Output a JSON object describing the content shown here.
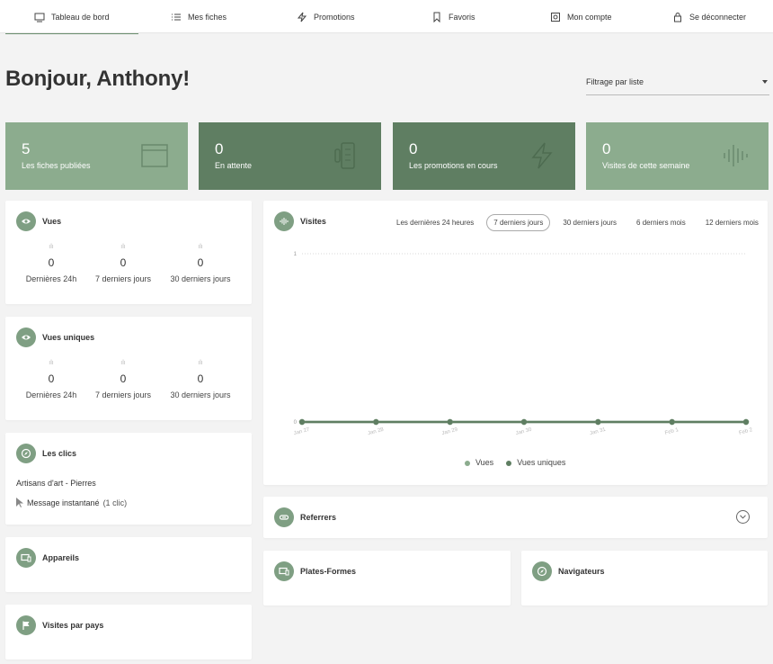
{
  "nav": {
    "items": [
      {
        "label": "Tableau de bord",
        "icon": "monitor-icon"
      },
      {
        "label": "Mes fiches",
        "icon": "list-icon"
      },
      {
        "label": "Promotions",
        "icon": "bolt-icon"
      },
      {
        "label": "Favoris",
        "icon": "bookmark-icon"
      },
      {
        "label": "Mon compte",
        "icon": "settings-icon"
      },
      {
        "label": "Se déconnecter",
        "icon": "lock-icon"
      }
    ],
    "active": "Tableau de bord"
  },
  "header": {
    "greeting": "Bonjour, Anthony!",
    "filter_label": "Filtrage par liste"
  },
  "stats": [
    {
      "value": "5",
      "label": "Les fiches publiées",
      "icon": "browser-icon"
    },
    {
      "value": "0",
      "label": "En attente",
      "icon": "battery-icon"
    },
    {
      "value": "0",
      "label": "Les promotions en cours",
      "icon": "bolt-icon"
    },
    {
      "value": "0",
      "label": "Visites de cette semaine",
      "icon": "soundwave-icon"
    }
  ],
  "vues": {
    "title": "Vues",
    "metrics": [
      {
        "value": "0",
        "label": "Dernières 24h"
      },
      {
        "value": "0",
        "label": "7 derniers jours"
      },
      {
        "value": "0",
        "label": "30 derniers jours"
      }
    ]
  },
  "vues_uniques": {
    "title": "Vues uniques",
    "metrics": [
      {
        "value": "0",
        "label": "Dernières 24h"
      },
      {
        "value": "0",
        "label": "7 derniers jours"
      },
      {
        "value": "0",
        "label": "30 derniers jours"
      }
    ]
  },
  "clics": {
    "title": "Les clics",
    "listing": "Artisans d'art - Pierres",
    "item_name": "Message instantané",
    "item_count": "(1 clic)"
  },
  "appareils": {
    "title": "Appareils"
  },
  "visites_pays": {
    "title": "Visites par pays"
  },
  "visites": {
    "title": "Visites",
    "tabs": [
      "Les dernières 24 heures",
      "7 derniers jours",
      "30 derniers jours",
      "6 derniers mois",
      "12 derniers mois"
    ],
    "active_tab": "7 derniers jours",
    "legend": [
      "Vues",
      "Vues uniques"
    ]
  },
  "referrers": {
    "title": "Referrers"
  },
  "plates_formes": {
    "title": "Plates-Formes"
  },
  "navigateurs": {
    "title": "Navigateurs"
  },
  "colors": {
    "accent": "#7f9f83",
    "stat_light": "#8cac8e",
    "stat_dark": "#5f7e62",
    "series_vues": "#8cac8e",
    "series_uniques": "#5f7e62"
  },
  "chart_data": {
    "type": "line",
    "categories": [
      "Jan 27",
      "Jan 28",
      "Jan 29",
      "Jan 30",
      "Jan 31",
      "Feb 1",
      "Feb 2"
    ],
    "series": [
      {
        "name": "Vues",
        "values": [
          0,
          0,
          0,
          0,
          0,
          0,
          0
        ]
      },
      {
        "name": "Vues uniques",
        "values": [
          0,
          0,
          0,
          0,
          0,
          0,
          0
        ]
      }
    ],
    "yticks": [
      "0",
      "1"
    ],
    "ylim": [
      0,
      1
    ],
    "grid": true,
    "legend": "bottom"
  }
}
